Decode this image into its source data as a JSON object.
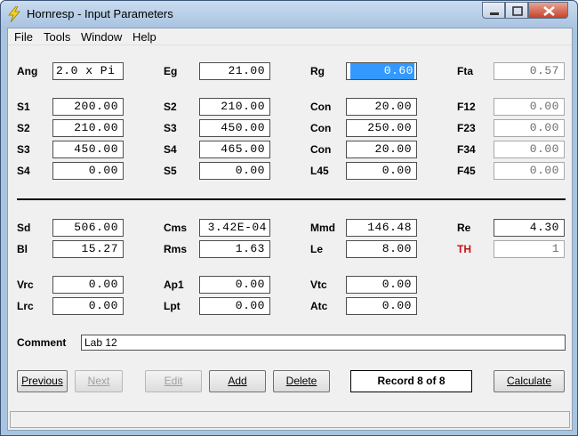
{
  "window": {
    "title": "Hornresp - Input Parameters",
    "icon": "lightning-icon",
    "controls": [
      "minimize-icon",
      "maximize-icon",
      "close-icon"
    ]
  },
  "menu": [
    "File",
    "Tools",
    "Window",
    "Help"
  ],
  "params": {
    "ang": {
      "label": "Ang",
      "value": "2.0 x Pi"
    },
    "eg": {
      "label": "Eg",
      "value": "21.00"
    },
    "rg": {
      "label": "Rg",
      "value": "0.60"
    },
    "fta": {
      "label": "Fta",
      "value": "0.57"
    },
    "s1": {
      "label": "S1",
      "value": "200.00"
    },
    "s2a": {
      "label": "S2",
      "value": "210.00"
    },
    "con1": {
      "label": "Con",
      "value": "20.00"
    },
    "f12": {
      "label": "F12",
      "value": "0.00"
    },
    "s2b": {
      "label": "S2",
      "value": "210.00"
    },
    "s3a": {
      "label": "S3",
      "value": "450.00"
    },
    "con2": {
      "label": "Con",
      "value": "250.00"
    },
    "f23": {
      "label": "F23",
      "value": "0.00"
    },
    "s3b": {
      "label": "S3",
      "value": "450.00"
    },
    "s4a": {
      "label": "S4",
      "value": "465.00"
    },
    "con3": {
      "label": "Con",
      "value": "20.00"
    },
    "f34": {
      "label": "F34",
      "value": "0.00"
    },
    "s4b": {
      "label": "S4",
      "value": "0.00"
    },
    "s5": {
      "label": "S5",
      "value": "0.00"
    },
    "l45": {
      "label": "L45",
      "value": "0.00"
    },
    "f45": {
      "label": "F45",
      "value": "0.00"
    },
    "sd": {
      "label": "Sd",
      "value": "506.00"
    },
    "cms": {
      "label": "Cms",
      "value": "3.42E-04"
    },
    "mmd": {
      "label": "Mmd",
      "value": "146.48"
    },
    "re": {
      "label": "Re",
      "value": "4.30"
    },
    "bl": {
      "label": "Bl",
      "value": "15.27"
    },
    "rms": {
      "label": "Rms",
      "value": "1.63"
    },
    "le": {
      "label": "Le",
      "value": "8.00"
    },
    "th": {
      "label": "TH",
      "value": "1"
    },
    "vrc": {
      "label": "Vrc",
      "value": "0.00"
    },
    "ap1": {
      "label": "Ap1",
      "value": "0.00"
    },
    "vtc": {
      "label": "Vtc",
      "value": "0.00"
    },
    "lrc": {
      "label": "Lrc",
      "value": "0.00"
    },
    "lpt": {
      "label": "Lpt",
      "value": "0.00"
    },
    "atc": {
      "label": "Atc",
      "value": "0.00"
    }
  },
  "comment": {
    "label": "Comment",
    "value": "Lab 12"
  },
  "buttons": {
    "previous": "Previous",
    "next": "Next",
    "edit": "Edit",
    "add": "Add",
    "delete": "Delete",
    "calculate": "Calculate"
  },
  "record": "Record 8 of 8",
  "colors": {
    "th_label": "#cc1111",
    "selection": "#3399ff"
  }
}
